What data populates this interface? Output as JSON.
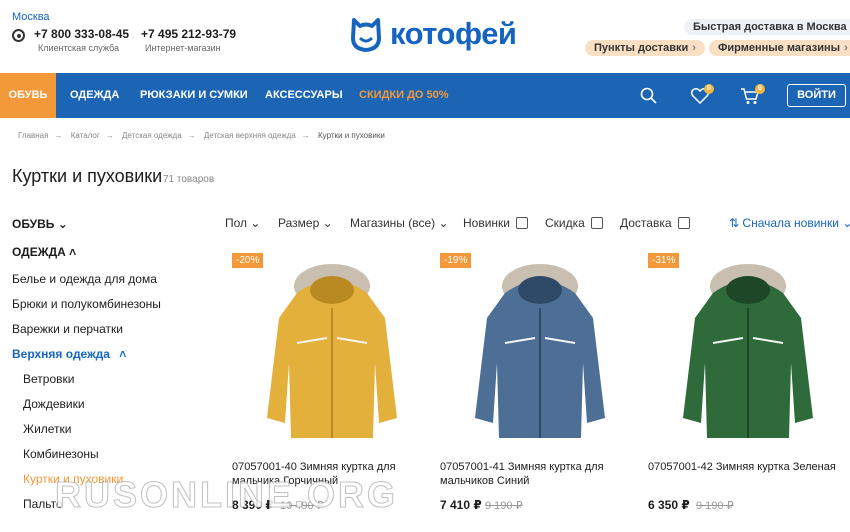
{
  "header": {
    "city": "Москва",
    "phone1": "+7 800 333-08-45",
    "phone1_label": "Клиентская служба",
    "phone2": "+7 495 212-93-79",
    "phone2_label": "Интернет-магазин",
    "logo": "котофей",
    "fast_delivery": "Быстрая доставка в Москва",
    "pickup_points": "Пункты доставки",
    "brand_stores": "Фирменные магазины"
  },
  "nav": {
    "shoes": "ОБУВЬ",
    "clothes": "ОДЕЖДА",
    "bags": "РЮКЗАКИ И СУМКИ",
    "accessories": "АКСЕССУАРЫ",
    "sale": "СКИДКИ ДО 50%",
    "favorites_count": "0",
    "cart_count": "0",
    "login": "ВОЙТИ"
  },
  "breadcrumb": [
    "Главная",
    "Каталог",
    "Детская одежда",
    "Детская верхняя одежда",
    "Куртки и пуховики"
  ],
  "page": {
    "title": "Куртки и пуховики",
    "count": "71 товаров"
  },
  "sidebar": {
    "shoes": "ОБУВЬ",
    "clothes": "ОДЕЖДА",
    "items": [
      "Белье и одежда для дома",
      "Брюки и полукомбинезоны",
      "Варежки и перчатки",
      "Верхняя одежда"
    ],
    "subitems": [
      "Ветровки",
      "Дождевики",
      "Жилетки",
      "Комбинезоны",
      "Куртки и пуховики",
      "Пальто"
    ]
  },
  "filters": {
    "sex": "Пол",
    "size": "Размер",
    "stores": "Магазины (все)",
    "new": "Новинки",
    "discount": "Скидка",
    "delivery": "Доставка",
    "sort": "Сначала новинки"
  },
  "products": [
    {
      "discount": "-20%",
      "name": "07057001-40 Зимняя куртка для мальчика Горчичный",
      "price": "8 390 ₽",
      "old_price": "10 490 ₽",
      "color": "#e3b03c"
    },
    {
      "discount": "-19%",
      "name": "07057001-41 Зимняя куртка для мальчиков Синий",
      "price": "7 410 ₽",
      "old_price": "9 190 ₽",
      "color": "#4d6f96"
    },
    {
      "discount": "-31%",
      "name": "07057001-42 Зимняя куртка Зеленая",
      "price": "6 350 ₽",
      "old_price": "9 190 ₽",
      "color": "#2f6b3a"
    }
  ],
  "watermark": "RUSONLINE.ORG"
}
